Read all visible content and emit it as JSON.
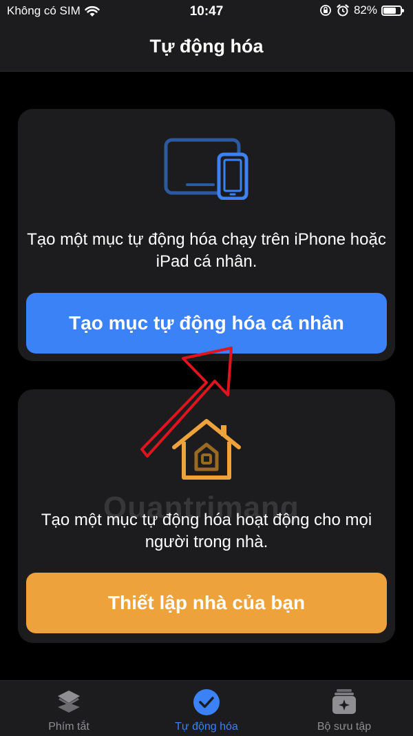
{
  "status_bar": {
    "carrier": "Không có SIM",
    "time": "10:47",
    "battery": "82%",
    "battery_level": 0.82
  },
  "nav": {
    "title": "Tự động hóa"
  },
  "personal_card": {
    "description": "Tạo một mục tự động hóa chạy trên iPhone hoặc iPad cá nhân.",
    "button_label": "Tạo mục tự động hóa cá nhân",
    "accent": "#3b82f6"
  },
  "home_card": {
    "description": "Tạo một mục tự động hóa hoạt động cho mọi người trong nhà.",
    "button_label": "Thiết lập nhà của bạn",
    "accent": "#eda23b"
  },
  "tabs": [
    {
      "label": "Phím tắt",
      "icon": "layers-icon",
      "active": false
    },
    {
      "label": "Tự động hóa",
      "icon": "checkmark-clock-icon",
      "active": true
    },
    {
      "label": "Bộ sưu tập",
      "icon": "gallery-sparkle-icon",
      "active": false
    }
  ]
}
